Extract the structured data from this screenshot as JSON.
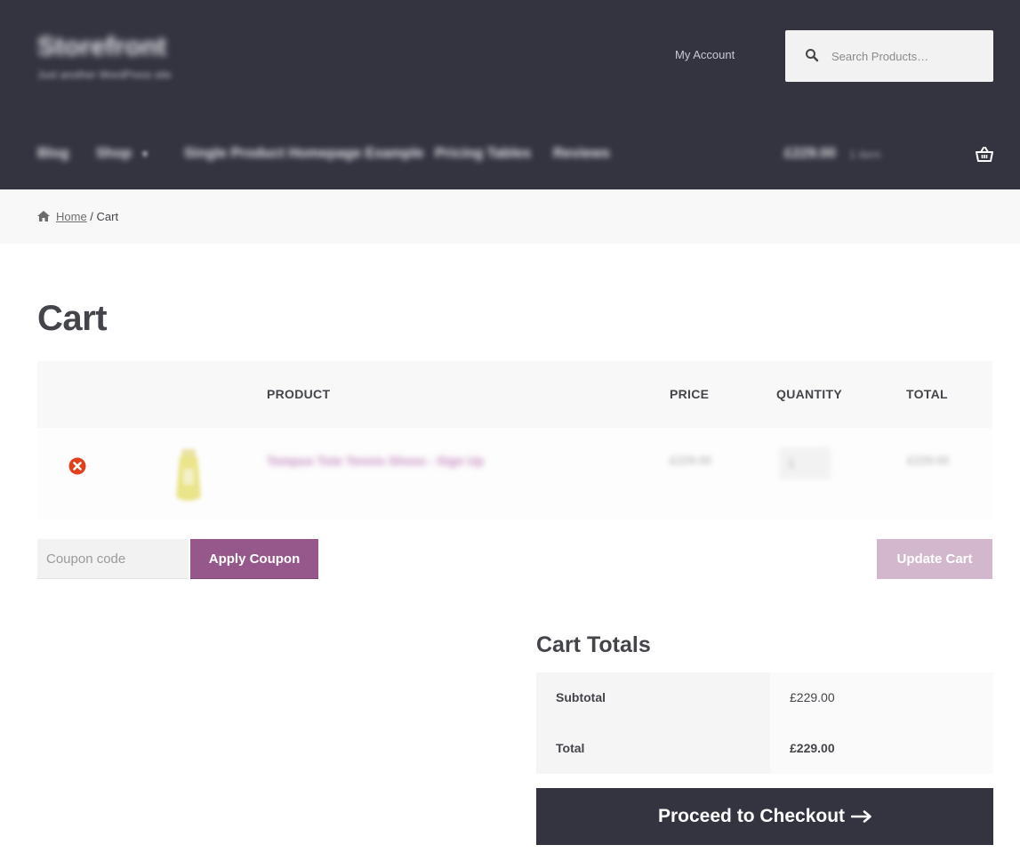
{
  "header": {
    "site_title": "Storefront",
    "site_tagline": "Just another WordPress site",
    "my_account": "My Account",
    "search_placeholder": "Search Products…"
  },
  "nav": {
    "items": [
      "Blog",
      "Shop",
      "Single Product Homepage Example",
      "Pricing Tables",
      "Reviews"
    ],
    "cart_amount": "£229.00",
    "cart_count": "1 item"
  },
  "breadcrumb": {
    "home": "Home",
    "separator": " / ",
    "current": "Cart"
  },
  "page_title": "Cart",
  "cart_table": {
    "headers": {
      "product": "PRODUCT",
      "price": "PRICE",
      "quantity": "QUANTITY",
      "total": "TOTAL"
    },
    "rows": [
      {
        "product": "Tempus Tote Tennis Shoes - Sign Up",
        "price": "£229.00",
        "quantity": "1",
        "total": "£229.00"
      }
    ]
  },
  "coupon": {
    "placeholder": "Coupon code",
    "apply_label": "Apply Coupon",
    "update_label": "Update Cart"
  },
  "totals": {
    "title": "Cart Totals",
    "subtotal_label": "Subtotal",
    "subtotal_value": "£229.00",
    "total_label": "Total",
    "total_value": "£229.00",
    "checkout_label": "Proceed to Checkout"
  },
  "colors": {
    "header_bg": "#333440",
    "accent_purple": "#96588a",
    "update_disabled": "#d3b8cd",
    "remove_red": "#e2401c"
  },
  "icons": {
    "search": "search-icon",
    "basket": "basket-icon",
    "home": "home-icon",
    "remove": "remove-item-icon",
    "arrow": "arrow-right-icon"
  }
}
